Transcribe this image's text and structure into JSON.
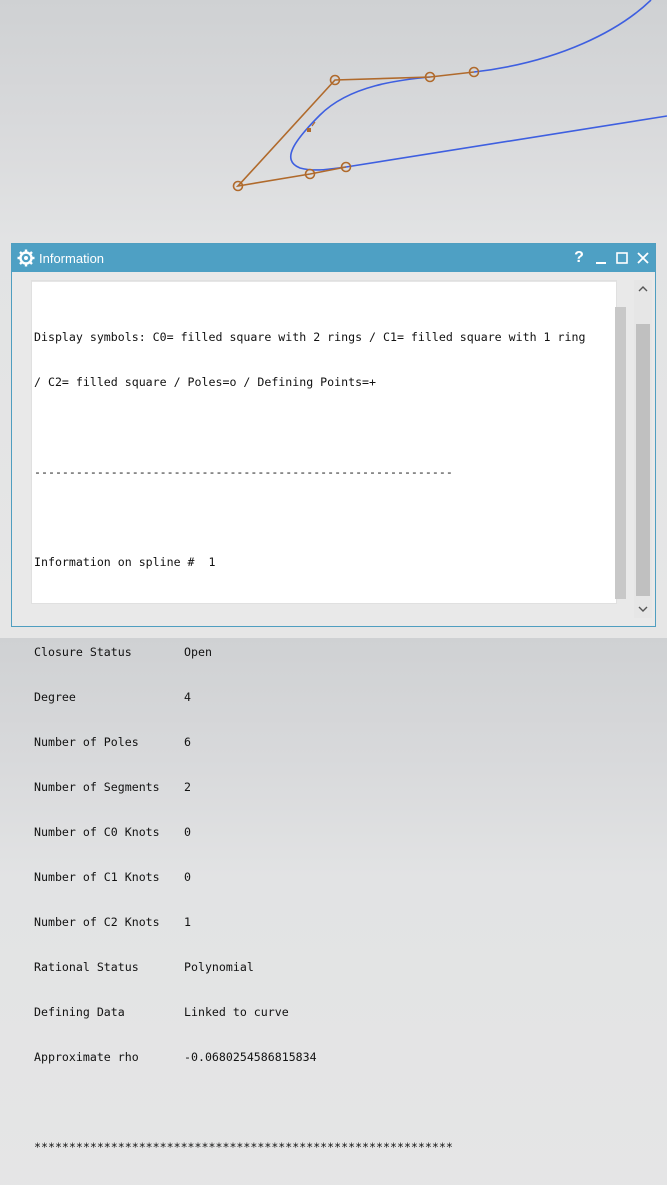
{
  "dialog": {
    "title": "Information",
    "help_label": "?",
    "gear_icon": "gear-icon",
    "accent_color": "#4ea0c4"
  },
  "info": {
    "display_symbols_line1": "Display symbols: C0= filled square with 2 rings / C1= filled square with 1 ring",
    "display_symbols_line2": "/ C2= filled square / Poles=o / Defining Points=+",
    "dash_rule": "------------------------------------------------------------",
    "spline_header": "Information on spline #  1",
    "rows": [
      {
        "key": "Closure Status",
        "value": "Open"
      },
      {
        "key": "Degree",
        "value": "4"
      },
      {
        "key": "Number of Poles",
        "value": "6"
      },
      {
        "key": "Number of Segments",
        "value": "2"
      },
      {
        "key": "Number of C0 Knots",
        "value": "0"
      },
      {
        "key": "Number of C1 Knots",
        "value": "0"
      },
      {
        "key": "Number of C2 Knots",
        "value": "1"
      },
      {
        "key": "Rational Status",
        "value": "Polynomial"
      },
      {
        "key": "Defining Data",
        "value": "Linked to curve"
      },
      {
        "key": "Approximate rho",
        "value": "-0.0680254586815834"
      }
    ],
    "star_rule": "************************************************************"
  },
  "viewport": {
    "curve_color": "#3e5fe0",
    "polygon_color": "#b06a2c"
  }
}
